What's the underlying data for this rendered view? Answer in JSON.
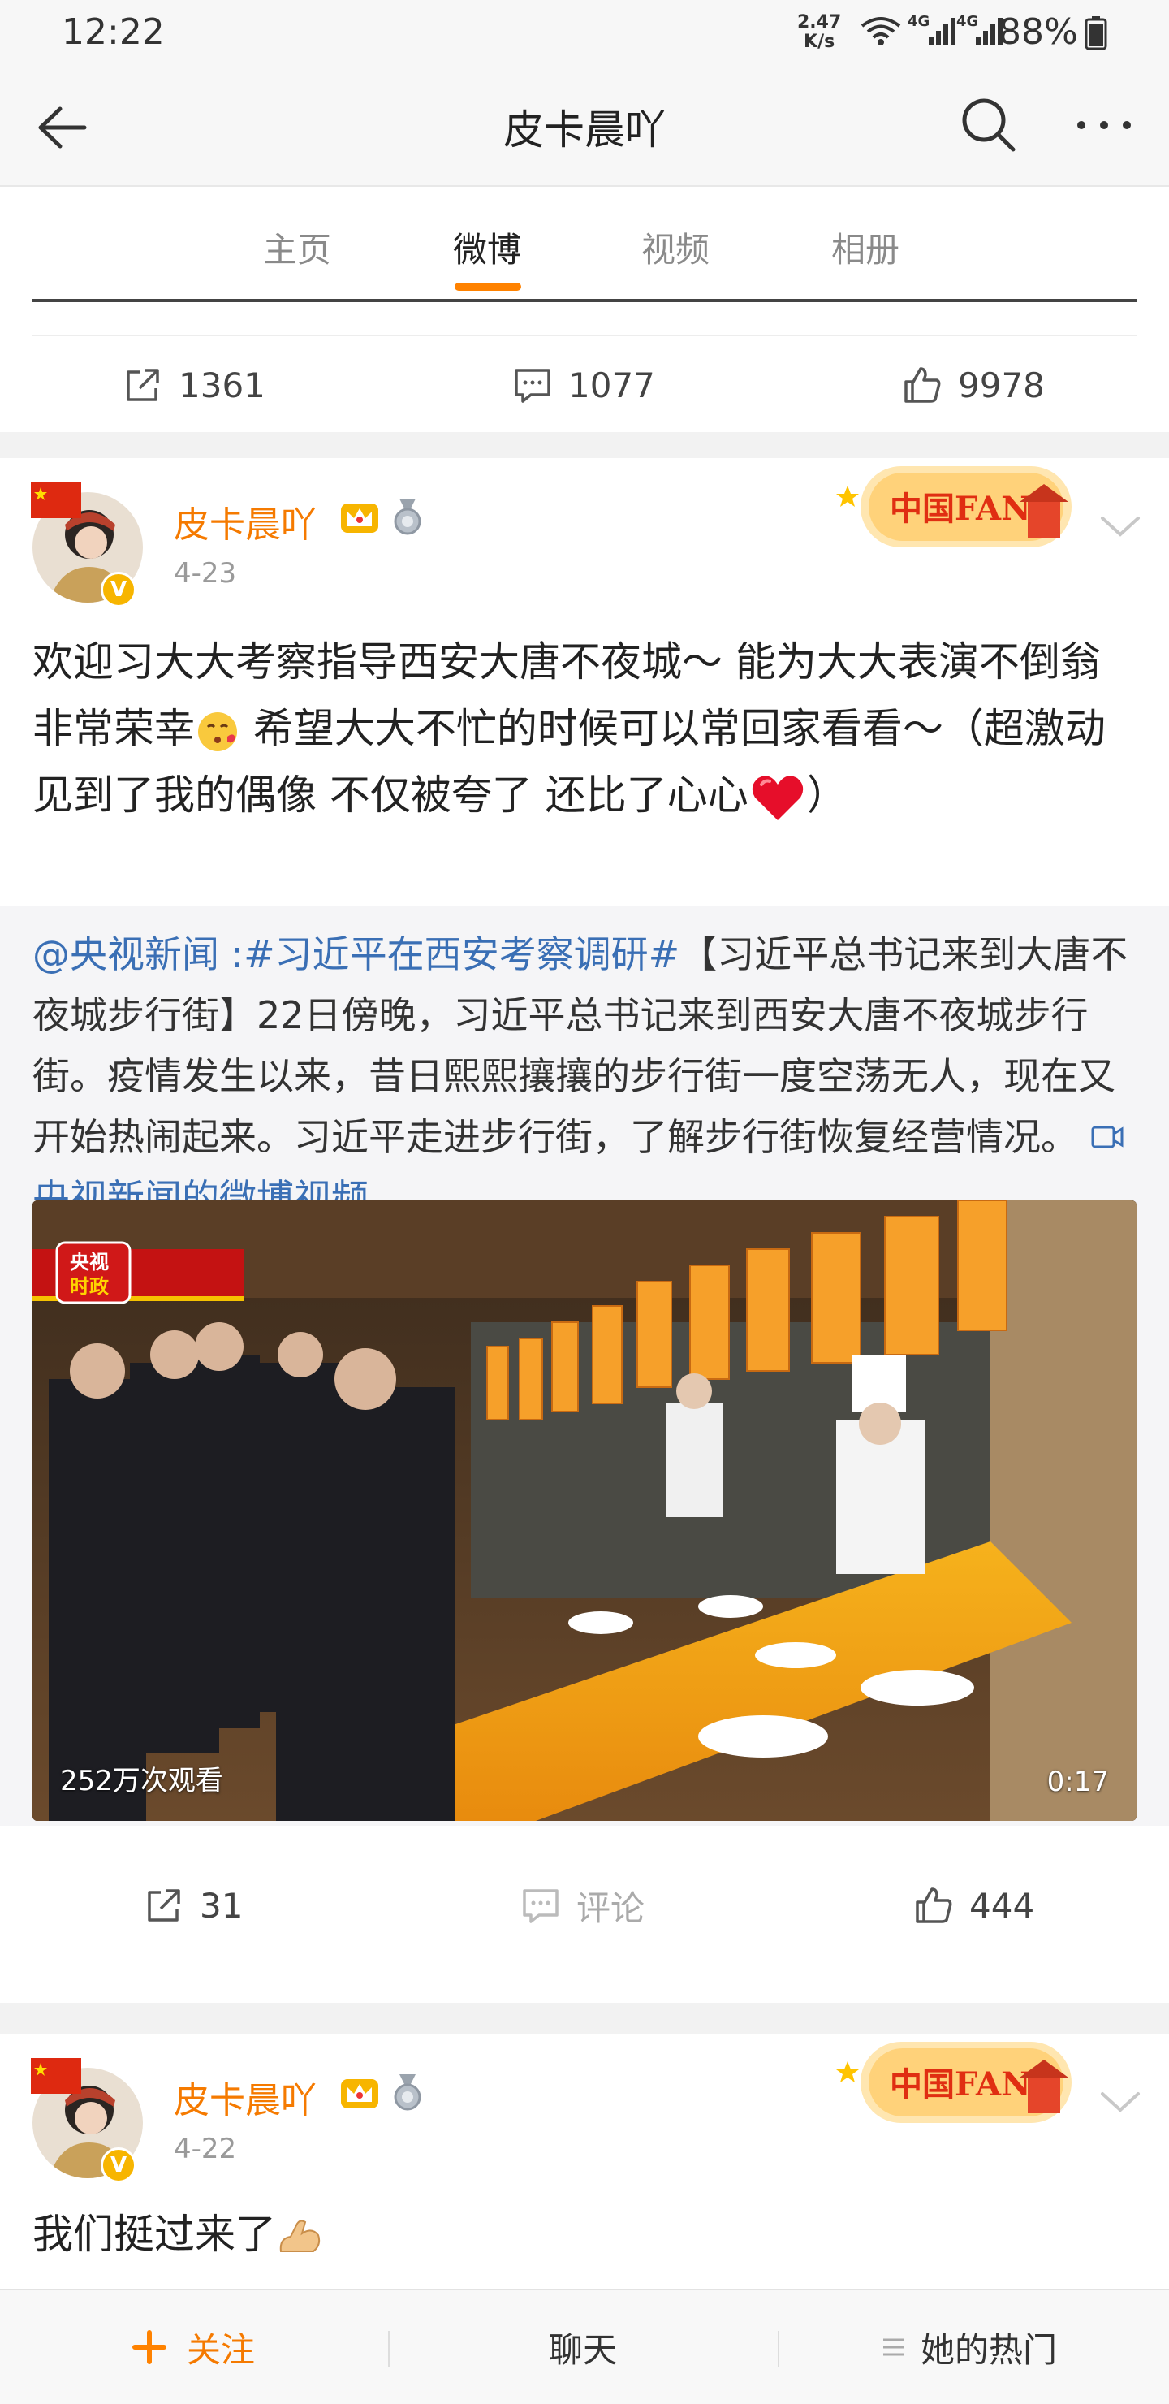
{
  "status": {
    "time": "12:22",
    "speed_value": "2.47",
    "speed_unit": "K/s",
    "net1": "4G",
    "net2": "4G",
    "battery": "88%"
  },
  "header": {
    "title": "皮卡晨吖"
  },
  "tabs": [
    {
      "label": "主页"
    },
    {
      "label": "微博"
    },
    {
      "label": "视频"
    },
    {
      "label": "相册"
    }
  ],
  "prev_post": {
    "reposts": "1361",
    "comments": "1077",
    "likes": "9978"
  },
  "post1": {
    "username": "皮卡晨吖",
    "date": "4-23",
    "text_part1": "欢迎习大大考察指导西安大唐不夜城～ 能为大大表演不倒翁非常荣幸",
    "text_part2": " 希望大大不忙的时候可以常回家看看～（超激动见到了我的偶像 不仅被夸了 还比了心心",
    "text_part3": "）",
    "repost_mention": "@央视新闻",
    "repost_topic": ":#习近平在西安考察调研#",
    "repost_body": "【习近平总书记来到大唐不夜城步行街】22日傍晚，习近平总书记来到西安大唐不夜城步行街。疫情发生以来，昔日熙熙攘攘的步行街一度空荡无人，现在又开始热闹起来。习近平走进步行街，了解步行街恢复经营情况。",
    "repost_video_link": "央视新闻的微博视频",
    "video_views": "252万次观看",
    "video_duration": "0:17",
    "video_logo": "央视\n时政",
    "reposts": "31",
    "comments_label": "评论",
    "likes": "444",
    "fans_badge": "中国FANS"
  },
  "post2": {
    "username": "皮卡晨吖",
    "date": "4-22",
    "text": "我们挺过来了",
    "fans_badge": "中国FANS"
  },
  "bottom": {
    "follow": "关注",
    "chat": "聊天",
    "hot": "她的热门"
  },
  "colors": {
    "accent": "#ff8200",
    "username": "#f57a00",
    "link": "#3a6fb5"
  }
}
